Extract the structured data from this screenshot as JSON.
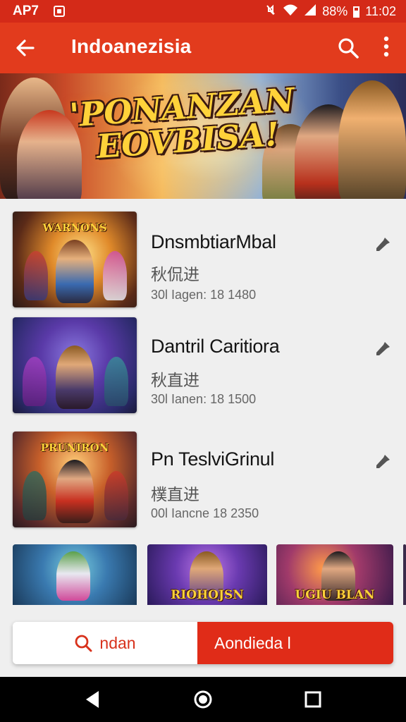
{
  "status_bar": {
    "carrier": "AP7",
    "battery_percent": "88%",
    "time": "11:02",
    "icons": [
      "notification-icon",
      "mute-icon",
      "wifi-icon",
      "signal-icon",
      "battery-icon"
    ]
  },
  "app_bar": {
    "title": "Indoanezisia",
    "back_icon": "back-arrow-icon",
    "search_icon": "search-icon",
    "more_icon": "more-vert-icon"
  },
  "banner": {
    "title_line1": "'PONANZAN",
    "title_line2": "EOVBISA!"
  },
  "list": {
    "items": [
      {
        "title": "DnsmbtiarMbal",
        "subtitle": "秋侃进",
        "meta": "30l Iagen: 18 1480",
        "thumb_tag": "WARNONS",
        "icon": "pin-icon"
      },
      {
        "title": "Dantril Caritiora",
        "subtitle": "秋直进",
        "meta": "30l Ianen: 18 1500",
        "thumb_tag": "",
        "icon": "pin-icon"
      },
      {
        "title": "Pn TeslviGrinul",
        "subtitle": "樸直进",
        "meta": "00l Iancne 18 2350",
        "thumb_tag": "PRUNIRON",
        "icon": "pin-icon"
      }
    ]
  },
  "thumb_row": {
    "items": [
      {
        "tag": ""
      },
      {
        "tag": "RIOHOJSN"
      },
      {
        "tag": "UGIU BLAN"
      }
    ]
  },
  "action_bar": {
    "search_label": "ndan",
    "primary_label": "Aondieda l"
  },
  "colors": {
    "primary": "#e23b1d",
    "status_bar": "#d42a18",
    "accent_red": "#e02c18",
    "background": "#efefef"
  },
  "nav_bar": {
    "icons": [
      "back-triangle-icon",
      "home-circle-icon",
      "recents-square-icon"
    ]
  }
}
